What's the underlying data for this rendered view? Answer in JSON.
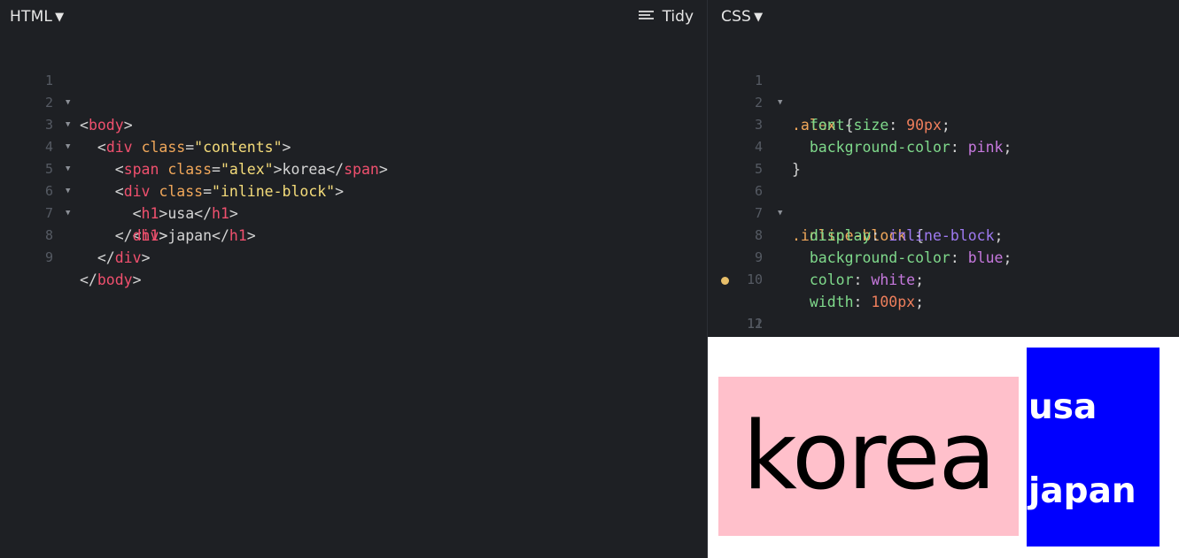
{
  "html_pane": {
    "title": "HTML",
    "tidy_label": "Tidy",
    "line_numbers": [
      "1",
      "2",
      "3",
      "4",
      "5",
      "6",
      "7",
      "8",
      "9"
    ]
  },
  "css_pane": {
    "title": "CSS",
    "line_numbers": [
      "1",
      "2",
      "3",
      "4",
      "5",
      "6",
      "7",
      "8",
      "9",
      "10",
      "11",
      "12"
    ]
  },
  "icons": {
    "dropdown": "caret-down-icon",
    "tidy": "lines-icon",
    "fold": "fold-triangle-icon",
    "modified": "dot-icon"
  },
  "colors": {
    "background": "#1e2024",
    "tag": "#f0506e",
    "attribute": "#f0a75a",
    "string": "#f5dc7a",
    "property": "#7fd98b",
    "number": "#ef7f5c",
    "keyword": "#c678dd"
  },
  "preview": {
    "span_text": "korea",
    "h1_first": "usa",
    "h1_second": "japan"
  }
}
